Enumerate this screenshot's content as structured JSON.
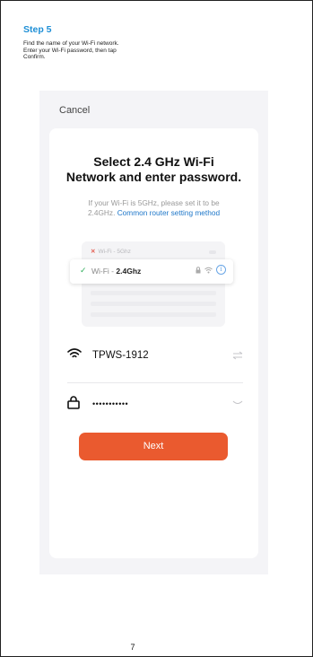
{
  "step": {
    "title": "Step 5"
  },
  "instructions": {
    "lines": [
      "Find the name of your Wi-Fi network.",
      "Enter your Wi-Fi password, then tap",
      "Confirm."
    ]
  },
  "screen": {
    "cancel_label": "Cancel",
    "heading_line1": "Select 2.4 GHz Wi-Fi",
    "heading_line2": "Network and enter password.",
    "subtext_line1": "If your Wi-Fi is 5GHz, please set it to be",
    "subtext_line2_prefix": "2.4GHz.",
    "subtext_link": "Common router setting method",
    "illustration": {
      "band_5g_label": "Wi-Fi - 5Ghz",
      "band_24_prefix": "Wi-Fi -",
      "band_24_value": "2.4Ghz"
    },
    "wifi_name": "TPWS-1912",
    "password_masked": "•••••••••••",
    "next_label": "Next"
  },
  "page_number": "7",
  "colors": {
    "step_title": "#1e8fd6",
    "link": "#1e77c9",
    "next_button": "#ea5a2f",
    "check": "#2fae5b",
    "cross": "#e35b4f"
  }
}
